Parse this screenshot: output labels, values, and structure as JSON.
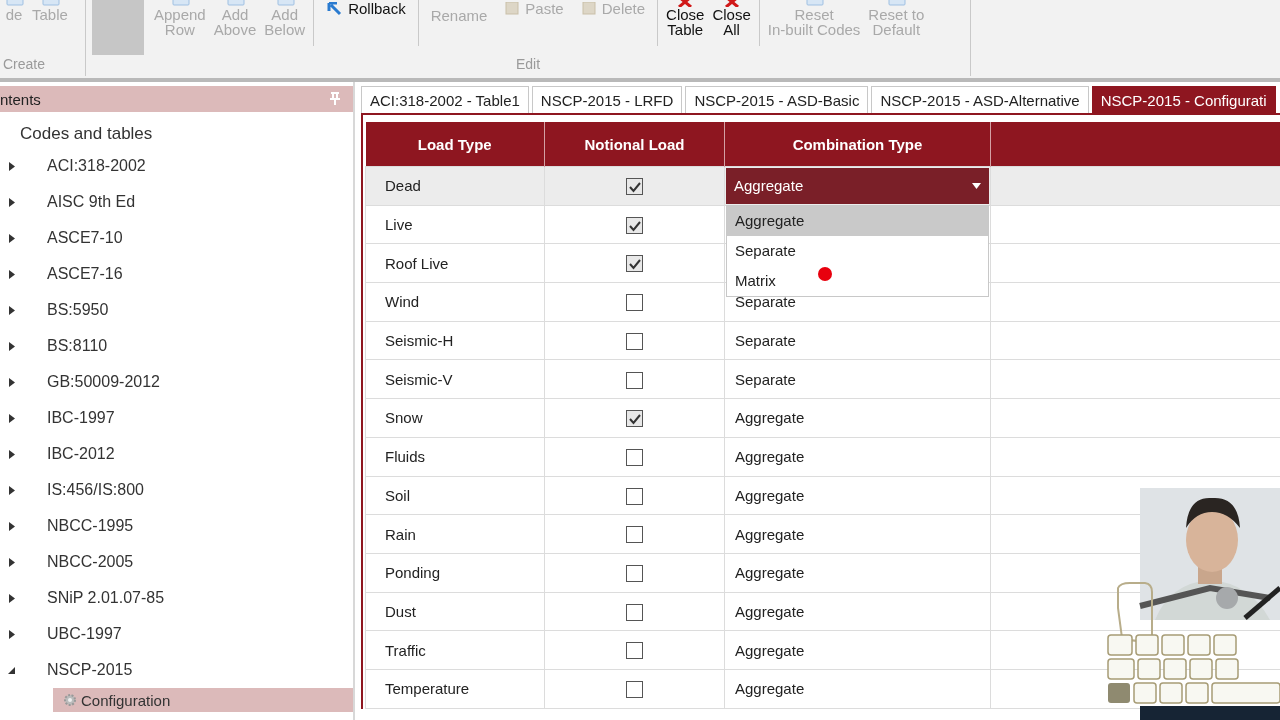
{
  "ribbon": {
    "groups": [
      {
        "label": "Create",
        "items": [
          {
            "kind": "large",
            "label": "de",
            "disabled": true
          },
          {
            "kind": "large",
            "label": "Table",
            "disabled": true
          }
        ]
      },
      {
        "label": "Edit",
        "items": [
          {
            "kind": "blank",
            "disabled": true
          },
          {
            "kind": "large",
            "label": "Append\nRow",
            "disabled": true
          },
          {
            "kind": "large",
            "label": "Add\nAbove",
            "disabled": true
          },
          {
            "kind": "large",
            "label": "Add\nBelow",
            "disabled": true
          },
          {
            "kind": "separator"
          },
          {
            "kind": "small",
            "label": "Rollback",
            "disabled": false
          },
          {
            "kind": "separator"
          },
          {
            "kind": "text",
            "label": "Rename",
            "disabled": true
          },
          {
            "kind": "small",
            "label": "Paste",
            "disabled": true
          },
          {
            "kind": "small",
            "label": "Delete",
            "disabled": true
          },
          {
            "kind": "separator"
          },
          {
            "kind": "large",
            "label": "Close\nTable",
            "disabled": false
          },
          {
            "kind": "large",
            "label": "Close\nAll",
            "disabled": false
          },
          {
            "kind": "separator"
          },
          {
            "kind": "large",
            "label": "Reset\nIn-built Codes",
            "disabled": true
          },
          {
            "kind": "large",
            "label": "Reset to\nDefault",
            "disabled": true
          }
        ]
      }
    ]
  },
  "sidebar": {
    "header": "ntents",
    "tree": [
      {
        "label": "Codes and tables",
        "selected": false,
        "children": [
          {
            "label": "ACI:318-2002",
            "expanded": false,
            "selected": false
          },
          {
            "label": "AISC 9th Ed",
            "expanded": false,
            "selected": false
          },
          {
            "label": "ASCE7-10",
            "expanded": false,
            "selected": false
          },
          {
            "label": "ASCE7-16",
            "expanded": false,
            "selected": false
          },
          {
            "label": "BS:5950",
            "expanded": false,
            "selected": false
          },
          {
            "label": "BS:8110",
            "expanded": false,
            "selected": false
          },
          {
            "label": "GB:50009-2012",
            "expanded": false,
            "selected": false
          },
          {
            "label": "IBC-1997",
            "expanded": false,
            "selected": false
          },
          {
            "label": "IBC-2012",
            "expanded": false,
            "selected": false
          },
          {
            "label": "IS:456/IS:800",
            "expanded": false,
            "selected": false
          },
          {
            "label": "NBCC-1995",
            "expanded": false,
            "selected": false
          },
          {
            "label": "NBCC-2005",
            "expanded": false,
            "selected": false
          },
          {
            "label": "SNiP 2.01.07-85",
            "expanded": false,
            "selected": false
          },
          {
            "label": "UBC-1997",
            "expanded": false,
            "selected": false
          },
          {
            "label": "NSCP-2015",
            "expanded": true,
            "selected": false,
            "children": [
              {
                "label": "Configuration",
                "selected": true
              }
            ]
          }
        ]
      }
    ]
  },
  "tabs": [
    {
      "label": "ACI:318-2002 - Table1",
      "selected": false
    },
    {
      "label": "NSCP-2015 - LRFD",
      "selected": false
    },
    {
      "label": "NSCP-2015 - ASD-Basic",
      "selected": false
    },
    {
      "label": "NSCP-2015 - ASD-Alternative",
      "selected": false
    },
    {
      "label": "NSCP-2015 - Configurati",
      "selected": true
    }
  ],
  "table": {
    "columns": [
      "Load Type",
      "Notional Load",
      "Combination Type"
    ],
    "rows": [
      {
        "load_type": "Dead",
        "notional": true,
        "combination": "Aggregate",
        "selected": true,
        "dropdown_open": true,
        "options": [
          {
            "label": "Aggregate",
            "selected": true
          },
          {
            "label": "Separate",
            "selected": false
          },
          {
            "label": "Matrix",
            "selected": false
          }
        ]
      },
      {
        "load_type": "Live",
        "notional": true,
        "selected": false,
        "dropdown_open": false
      },
      {
        "load_type": "Roof Live",
        "notional": true,
        "selected": false,
        "dropdown_open": false
      },
      {
        "load_type": "Wind",
        "notional": false,
        "combination": "Separate",
        "selected": false,
        "dropdown_open": false
      },
      {
        "load_type": "Seismic-H",
        "notional": false,
        "combination": "Separate",
        "selected": false,
        "dropdown_open": false
      },
      {
        "load_type": "Seismic-V",
        "notional": false,
        "combination": "Separate",
        "selected": false,
        "dropdown_open": false
      },
      {
        "load_type": "Snow",
        "notional": true,
        "combination": "Aggregate",
        "selected": false,
        "dropdown_open": false
      },
      {
        "load_type": "Fluids",
        "notional": false,
        "combination": "Aggregate",
        "selected": false,
        "dropdown_open": false
      },
      {
        "load_type": "Soil",
        "notional": false,
        "combination": "Aggregate",
        "selected": false,
        "dropdown_open": false
      },
      {
        "load_type": "Rain",
        "notional": false,
        "combination": "Aggregate",
        "selected": false,
        "dropdown_open": false
      },
      {
        "load_type": "Ponding",
        "notional": false,
        "combination": "Aggregate",
        "selected": false,
        "dropdown_open": false
      },
      {
        "load_type": "Dust",
        "notional": false,
        "combination": "Aggregate",
        "selected": false,
        "dropdown_open": false
      },
      {
        "load_type": "Traffic",
        "notional": false,
        "combination": "Aggregate",
        "selected": false,
        "dropdown_open": false
      },
      {
        "load_type": "Temperature",
        "notional": false,
        "combination": "Aggregate",
        "selected": false,
        "dropdown_open": false
      }
    ]
  }
}
